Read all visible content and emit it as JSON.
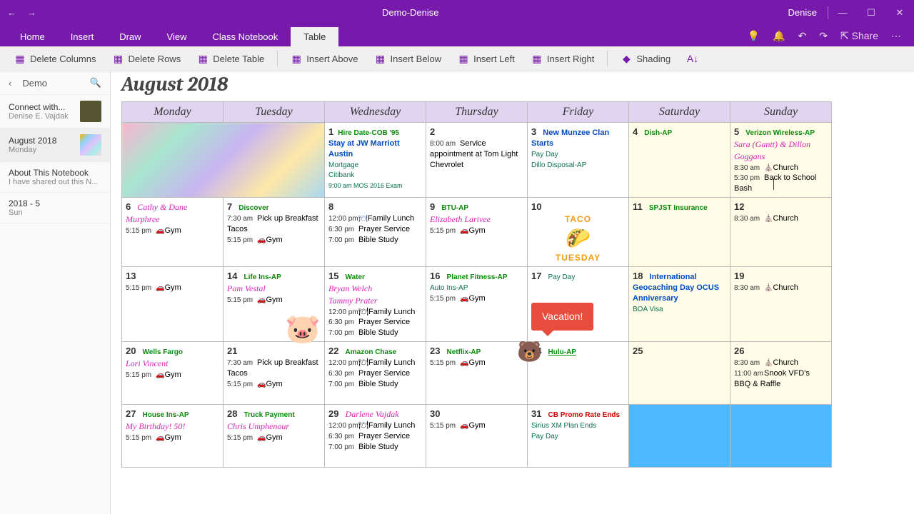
{
  "titlebar": {
    "title": "Demo-Denise",
    "user": "Denise"
  },
  "tabs": [
    "Home",
    "Insert",
    "Draw",
    "View",
    "Class Notebook",
    "Table"
  ],
  "activeTab": 5,
  "ribbonActions": {
    "share": "Share"
  },
  "toolbar": {
    "delCols": "Delete Columns",
    "delRows": "Delete Rows",
    "delTable": "Delete Table",
    "insAbove": "Insert Above",
    "insBelow": "Insert Below",
    "insLeft": "Insert Left",
    "insRight": "Insert Right",
    "shading": "Shading"
  },
  "sidebar": {
    "search": "Demo",
    "items": [
      {
        "t1": "Connect with...",
        "t2": "Denise E. Vajdak"
      },
      {
        "t1": "August 2018",
        "t2": "Monday"
      },
      {
        "t1": "About This Notebook",
        "t2": "I have shared out this N..."
      },
      {
        "t1": "2018 - 5",
        "t2": "Sun"
      }
    ]
  },
  "page": {
    "title": "August 2018"
  },
  "dayHeaders": [
    "Monday",
    "Tuesday",
    "Wednesday",
    "Thursday",
    "Friday",
    "Saturday",
    "Sunday"
  ],
  "cells": {
    "w1": {
      "wed": {
        "d": "1",
        "bill": "Hire Date-COB '95",
        "event": "Stay at JW Marriott Austin",
        "sub1": "Mortgage",
        "sub2": "Citibank",
        "small": "9:00 am   MOS 2016 Exam"
      },
      "thu": {
        "d": "2",
        "time": "8:00 am",
        "txt": "Service appointment at Tom Light Chevrolet"
      },
      "fri": {
        "d": "3",
        "event": "New Munzee Clan Starts",
        "l1": "Pay Day",
        "l2": "Dillo Disposal-AP"
      },
      "sat": {
        "d": "4",
        "bill": "Dish-AP"
      },
      "sun": {
        "d": "5",
        "bill": "Verizon Wireless-AP",
        "bday": "Sara (Gantt) & Dillon Goggans",
        "t1": "8:30 am",
        "e1": "Church",
        "t2": "5:30 pm",
        "e2": "Back to School Bash"
      }
    },
    "w2": {
      "mon": {
        "d": "6",
        "bday": "Cathy & Dane Murphree",
        "t1": "5:15 pm",
        "e1": "Gym"
      },
      "tue": {
        "d": "7",
        "bill": "Discover",
        "t1": "7:30 am",
        "e1": "Pick up Breakfast Tacos",
        "t2": "5:15 pm",
        "e2": "Gym"
      },
      "wed": {
        "d": "8",
        "t1": "12:00 pm",
        "e1": "Family Lunch",
        "t2": "6:30 pm",
        "e2": "Prayer Service",
        "t3": "7:00 pm",
        "e3": "Bible Study"
      },
      "thu": {
        "d": "9",
        "bill": "BTU-AP",
        "bday": "Elizabeth Larivee",
        "t1": "5:15 pm",
        "e1": "Gym"
      },
      "fri": {
        "d": "10",
        "taco1": "TACO",
        "taco2": "TUESDAY"
      },
      "sat": {
        "d": "11",
        "bill": "SPJST Insurance"
      },
      "sun": {
        "d": "12",
        "t1": "8:30 am",
        "e1": "Church"
      }
    },
    "w3": {
      "mon": {
        "d": "13",
        "t1": "5:15 pm",
        "e1": "Gym"
      },
      "tue": {
        "d": "14",
        "bill": "Life Ins-AP",
        "bday": "Pam Vestal",
        "t1": "5:15 pm",
        "e1": "Gym"
      },
      "wed": {
        "d": "15",
        "bill": "Water",
        "bday1": "Bryan Welch",
        "bday2": "Tammy Prater",
        "t1": "12:00 pm",
        "e1": "Family Lunch",
        "t2": "6:30 pm",
        "e2": "Prayer Service",
        "t3": "7:00 pm",
        "e3": "Bible Study"
      },
      "thu": {
        "d": "16",
        "bill": "Planet Fitness-AP",
        "l1": "Auto Ins-AP",
        "t1": "5:15 pm",
        "e1": "Gym"
      },
      "fri": {
        "d": "17",
        "l1": "Pay Day",
        "vac": "Vacation!"
      },
      "sat": {
        "d": "18",
        "event": "International Geocaching Day OCUS Anniversary",
        "sub": "BOA Visa"
      },
      "sun": {
        "d": "19",
        "t1": "8:30 am",
        "e1": "Church"
      }
    },
    "w4": {
      "mon": {
        "d": "20",
        "bill": "Wells Fargo",
        "bday": "Lori Vincent",
        "t1": "5:15 pm",
        "e1": "Gym"
      },
      "tue": {
        "d": "21",
        "t1": "7:30 am",
        "e1": "Pick up Breakfast Tacos",
        "t2": "5:15 pm",
        "e2": "Gym"
      },
      "wed": {
        "d": "22",
        "bill": "Amazon Chase",
        "t1": "12:00 pm",
        "e1": "Family Lunch",
        "t2": "6:30 pm",
        "e2": "Prayer Service",
        "t3": "7:00 pm",
        "e3": "Bible Study"
      },
      "thu": {
        "d": "23",
        "bill": "Netflix-AP",
        "t1": "5:15 pm",
        "e1": "Gym"
      },
      "fri": {
        "d": "24",
        "bill": "Hulu-AP"
      },
      "sat": {
        "d": "25"
      },
      "sun": {
        "d": "26",
        "t1": "8:30 am",
        "e1": "Church",
        "t2": "11:00 am",
        "e2": "Snook VFD's BBQ & Raffle"
      }
    },
    "w5": {
      "mon": {
        "d": "27",
        "bill": "House Ins-AP",
        "bday": "My Birthday! 50!",
        "t1": "5:15 pm",
        "e1": "Gym"
      },
      "tue": {
        "d": "28",
        "bill": "Truck Payment",
        "bday": "Chris Umphenour",
        "t1": "5:15 pm",
        "e1": "Gym"
      },
      "wed": {
        "d": "29",
        "bday": "Darlene Vajdak",
        "t1": "12:00 pm",
        "e1": "Family Lunch",
        "t2": "6:30 pm",
        "e2": "Prayer Service",
        "t3": "7:00 pm",
        "e3": "Bible Study"
      },
      "thu": {
        "d": "30",
        "t1": "5:15 pm",
        "e1": "Gym"
      },
      "fri": {
        "d": "31",
        "billred": "CB Promo Rate Ends",
        "l1": "Sirius XM Plan Ends",
        "l2": "Pay Day"
      }
    }
  }
}
